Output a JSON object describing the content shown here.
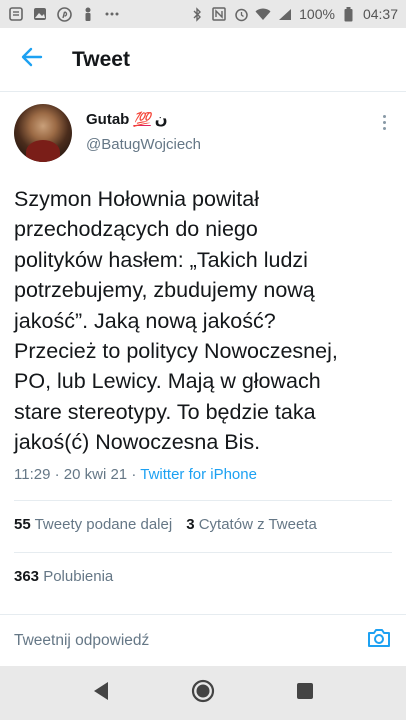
{
  "status_bar": {
    "battery": "100%",
    "time": "04:37",
    "icons": [
      "notes-icon",
      "image-icon",
      "pinterest-icon",
      "figure-icon",
      "dots-icon",
      "bluetooth-icon",
      "nfc-icon",
      "alarm-icon",
      "wifi-icon",
      "signal-icon",
      "battery-icon"
    ]
  },
  "header": {
    "title": "Tweet",
    "back_icon": "back-arrow-icon"
  },
  "tweet": {
    "display_name": "Gutab",
    "name_emoji": "💯",
    "name_suffix": "ن",
    "handle": "@BatugWojciech",
    "text": "Szymon Hołownia powitał\nprzechodzących do niego\npolityków hasłem: „Takich ludzi\npotrzebujemy, zbudujemy nową\njakość”. Jaką nową jakość?\nPrzecież to politycy Nowoczesnej,\nPO, lub Lewicy. Mają w głowach\nstare stereotypy. To będzie taka\njakoś(ć) Nowoczesna Bis.",
    "time": "11:29",
    "date": "20 kwi 21",
    "separator": "·",
    "source": "Twitter for iPhone"
  },
  "stats": {
    "retweets_count": "55",
    "retweets_label": "Tweety podane dalej",
    "quotes_count": "3",
    "quotes_label": "Cytatów z Tweeta",
    "likes_count": "363",
    "likes_label": "Polubienia"
  },
  "reply": {
    "placeholder": "Tweetnij odpowiedź"
  },
  "colors": {
    "accent": "#1da1f2",
    "secondary_text": "#657786",
    "primary_text": "#14171a"
  }
}
